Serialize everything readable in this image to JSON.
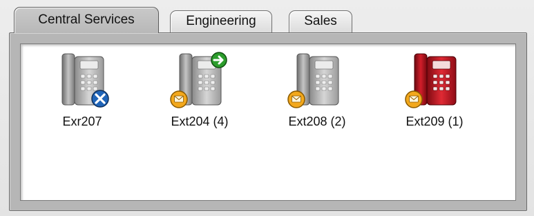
{
  "tabs": [
    {
      "label": "Central Services",
      "active": true
    },
    {
      "label": "Engineering",
      "active": false
    },
    {
      "label": "Sales",
      "active": false
    }
  ],
  "phones": [
    {
      "label": "Exr207",
      "color": "gray",
      "status": "offline",
      "badges": [
        "blue-x-icon"
      ]
    },
    {
      "label": "Ext204 (4)",
      "color": "gray",
      "status": "forwarded",
      "badges": [
        "voicemail-envelope-icon",
        "green-forward-arrow-icon"
      ]
    },
    {
      "label": "Ext208 (2)",
      "color": "gray",
      "status": "voicemail",
      "badges": [
        "voicemail-envelope-icon"
      ]
    },
    {
      "label": "Ext209 (1)",
      "color": "red",
      "status": "busy",
      "badges": [
        "voicemail-envelope-icon"
      ]
    }
  ],
  "colors": {
    "gray_phone_body": "#b9b9b9",
    "red_phone_body": "#c3101c",
    "voicemail_badge": "#f3a81c",
    "offline_badge": "#1f64b8",
    "forward_badge": "#2c9d2c"
  }
}
